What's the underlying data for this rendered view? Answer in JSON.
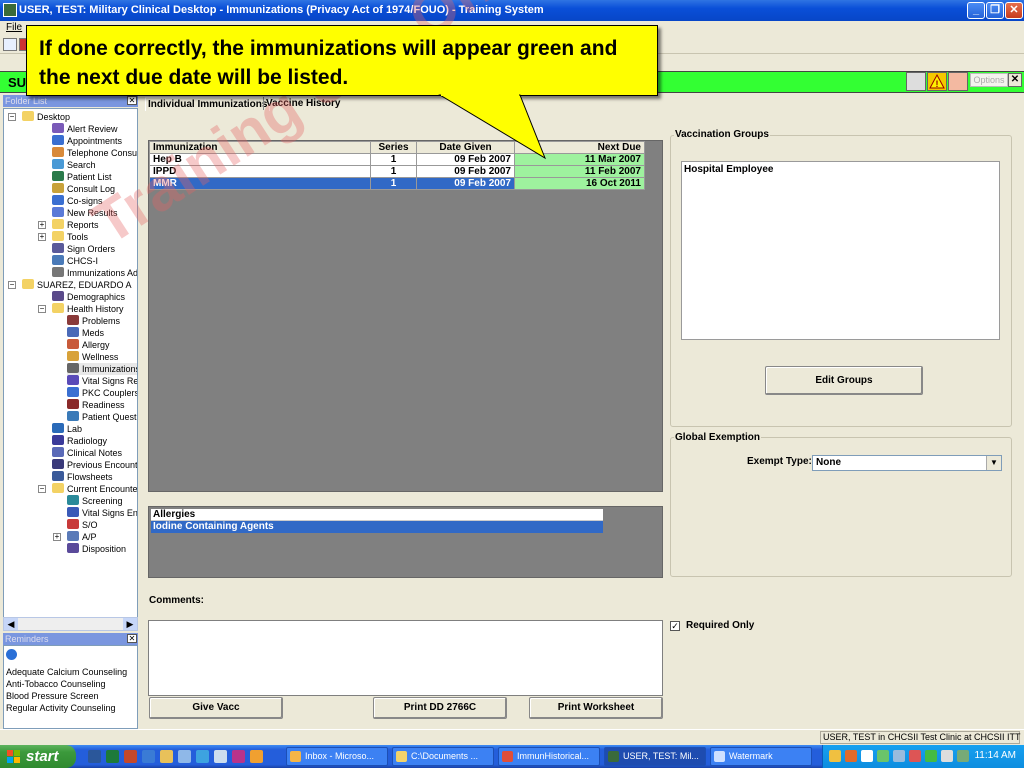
{
  "window": {
    "title": "USER, TEST: Military Clinical Desktop - Immunizations (Privacy Act of 1974/FOUO) -  Training System",
    "minimize": "_",
    "maximize": "❐",
    "close": "✕"
  },
  "menu": {
    "file": "File"
  },
  "patient_bar": {
    "name": "SU",
    "options": "Options",
    "close": "✕"
  },
  "callout": {
    "text": "If done correctly, the immunizations will appear green and the next due date will be listed."
  },
  "watermark": "Training Use Only",
  "folder_list": {
    "title": "Folder List",
    "items": [
      "Desktop",
      "Alert Review",
      "Appointments",
      "Telephone Consults",
      "Search",
      "Patient List",
      "Consult Log",
      "Co-signs",
      "New Results",
      "Reports",
      "Tools",
      "Sign Orders",
      "CHCS-I",
      "Immunizations Admin",
      "SUAREZ, EDUARDO A",
      "Demographics",
      "Health History",
      "Problems",
      "Meds",
      "Allergy",
      "Wellness",
      "Immunizations",
      "Vital Signs Review",
      "PKC Couplers",
      "Readiness",
      "Patient Questionnaire",
      "Lab",
      "Radiology",
      "Clinical Notes",
      "Previous Encounters",
      "Flowsheets",
      "Current Encounter",
      "Screening",
      "Vital Signs Entry",
      "S/O",
      "A/P",
      "Disposition"
    ]
  },
  "reminders": {
    "title": "Reminders",
    "items": [
      "Adequate Calcium Counseling",
      "Anti-Tobacco Counseling",
      "Blood Pressure Screen",
      "Regular Activity Counseling"
    ]
  },
  "tabs": [
    "Individual Immunizations",
    "Vaccine History"
  ],
  "immunizations": {
    "headers": [
      "Immunization",
      "Series",
      "Date Given",
      "Next Due"
    ],
    "rows": [
      [
        "Hep B",
        "1",
        "09 Feb 2007",
        "11 Mar 2007"
      ],
      [
        "IPPD",
        "1",
        "09 Feb 2007",
        "11 Feb 2007"
      ],
      [
        "MMR",
        "1",
        "09 Feb 2007",
        "16 Oct 2011"
      ]
    ]
  },
  "allergies": {
    "header": "Allergies",
    "rows": [
      "Iodine Containing Agents"
    ]
  },
  "comments_label": "Comments:",
  "buttons": {
    "give_vacc": "Give Vacc",
    "print_dd": "Print DD 2766C",
    "print_worksheet": "Print Worksheet",
    "edit_groups": "Edit Groups"
  },
  "vaccination_groups": {
    "label": "Vaccination Groups",
    "items": [
      "Hospital Employee"
    ]
  },
  "global_exemption": {
    "label": "Global Exemption",
    "exempt_type_label": "Exempt Type:",
    "exempt_type_value": "None"
  },
  "required_only": {
    "label": "Required Only",
    "checked": true
  },
  "status_bar": {
    "text": "USER, TEST in CHCSII Test Clinic at CHCSII ITT"
  },
  "taskbar": {
    "start": "start",
    "tasks": [
      "Inbox - Microso...",
      "C:\\Documents ...",
      "ImmunHistorical...",
      "USER, TEST: Mil...",
      "Watermark"
    ],
    "clock": "11:14 AM"
  },
  "colors": {
    "next_due_green": "#9ef29e",
    "patient_bar": "#33ff33",
    "callout": "#ffff00",
    "selection": "#3169c6"
  }
}
